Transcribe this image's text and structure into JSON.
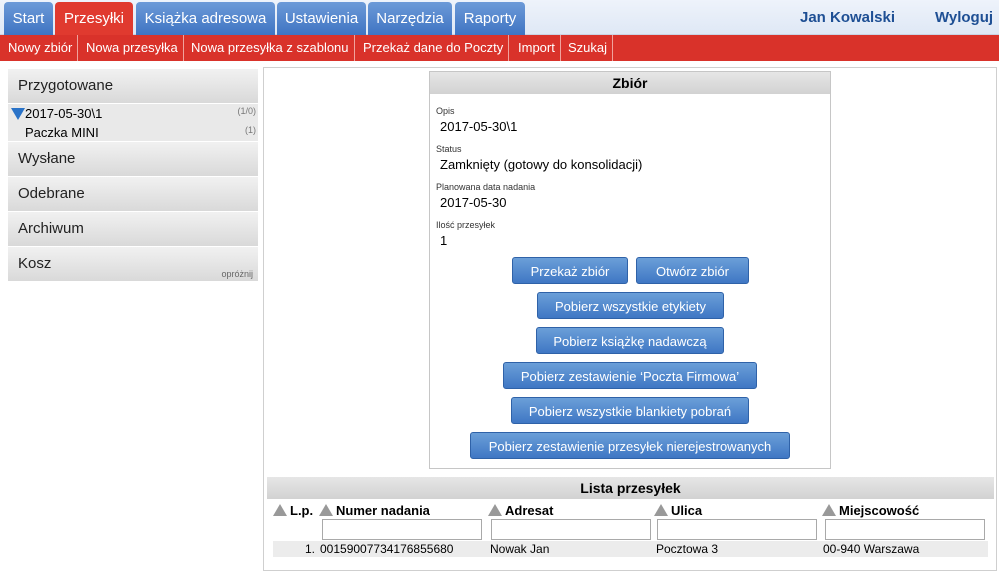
{
  "nav": {
    "tabs": [
      {
        "label": "Start",
        "active": false
      },
      {
        "label": "Przesyłki",
        "active": true
      },
      {
        "label": "Książka adresowa",
        "active": false
      },
      {
        "label": "Ustawienia",
        "active": false
      },
      {
        "label": "Narzędzia",
        "active": false
      },
      {
        "label": "Raporty",
        "active": false
      }
    ],
    "user_name": "Jan Kowalski",
    "logout": "Wyloguj"
  },
  "submenu": [
    "Nowy zbiór",
    "Nowa przesyłka",
    "Nowa przesyłka z szablonu",
    "Przekaż dane do Poczty",
    "Import",
    "Szukaj"
  ],
  "sidebar": {
    "przygotowane": "Przygotowane",
    "tree": [
      {
        "label": "2017-05-30\\1",
        "count": "(1/0)"
      },
      {
        "label": "Paczka MINI",
        "count": "(1)"
      }
    ],
    "wyslane": "Wysłane",
    "odebrane": "Odebrane",
    "archiwum": "Archiwum",
    "kosz": "Kosz",
    "kosz_action": "opróżnij"
  },
  "zbior": {
    "title": "Zbiór",
    "opis_label": "Opis",
    "opis": "2017-05-30\\1",
    "status_label": "Status",
    "status": "Zamknięty (gotowy do konsolidacji)",
    "data_label": "Planowana data nadania",
    "data": "2017-05-30",
    "ilosc_label": "Ilość przesyłek",
    "ilosc": "1",
    "buttons": {
      "przekaz": "Przekaż zbiór",
      "otworz": "Otwórz zbiór",
      "etykiety": "Pobierz wszystkie etykiety",
      "ksiazka": "Pobierz książkę nadawczą",
      "zestawienie_pf": "Pobierz zestawienie ‘Poczta Firmowa’",
      "blankiety": "Pobierz wszystkie blankiety pobrań",
      "nierejestrowane": "Pobierz zestawienie przesyłek nierejestrowanych"
    }
  },
  "lista": {
    "title": "Lista przesyłek",
    "columns": [
      "L.p.",
      "Numer nadania",
      "Adresat",
      "Ulica",
      "Miejscowość"
    ],
    "rows": [
      {
        "lp": "1.",
        "numer": "00159007734176855680",
        "adresat": "Nowak Jan",
        "ulica": "Pocztowa 3",
        "miejscowosc": "00-940 Warszawa"
      }
    ]
  }
}
